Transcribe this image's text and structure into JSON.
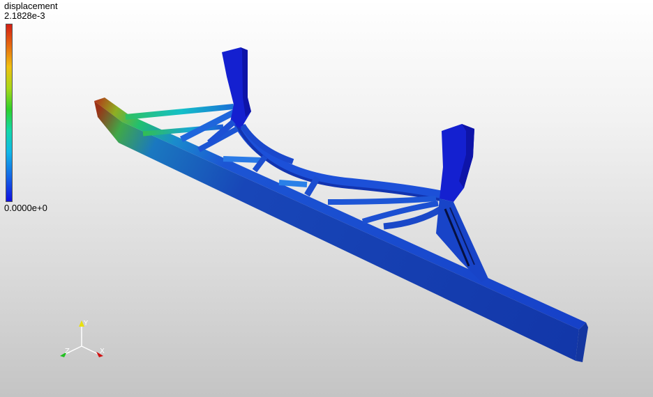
{
  "legend": {
    "title": "displacement",
    "max_label": "2.1828e-3",
    "min_label": "0.0000e+0",
    "colormap": [
      "#d21e14",
      "#e66a10",
      "#f0c010",
      "#a8d818",
      "#2ed02a",
      "#12d8a8",
      "#10b8e8",
      "#1466e6",
      "#1010e0"
    ]
  },
  "triad": {
    "x_label": "X",
    "y_label": "Y",
    "z_label": "Z",
    "x_color": "#d01010",
    "y_color": "#e8e010",
    "z_color": "#20c020"
  },
  "model": {
    "description_icon": "fea-beam-model",
    "low_color": "#0a2fd8",
    "high_color": "#c0301a"
  }
}
